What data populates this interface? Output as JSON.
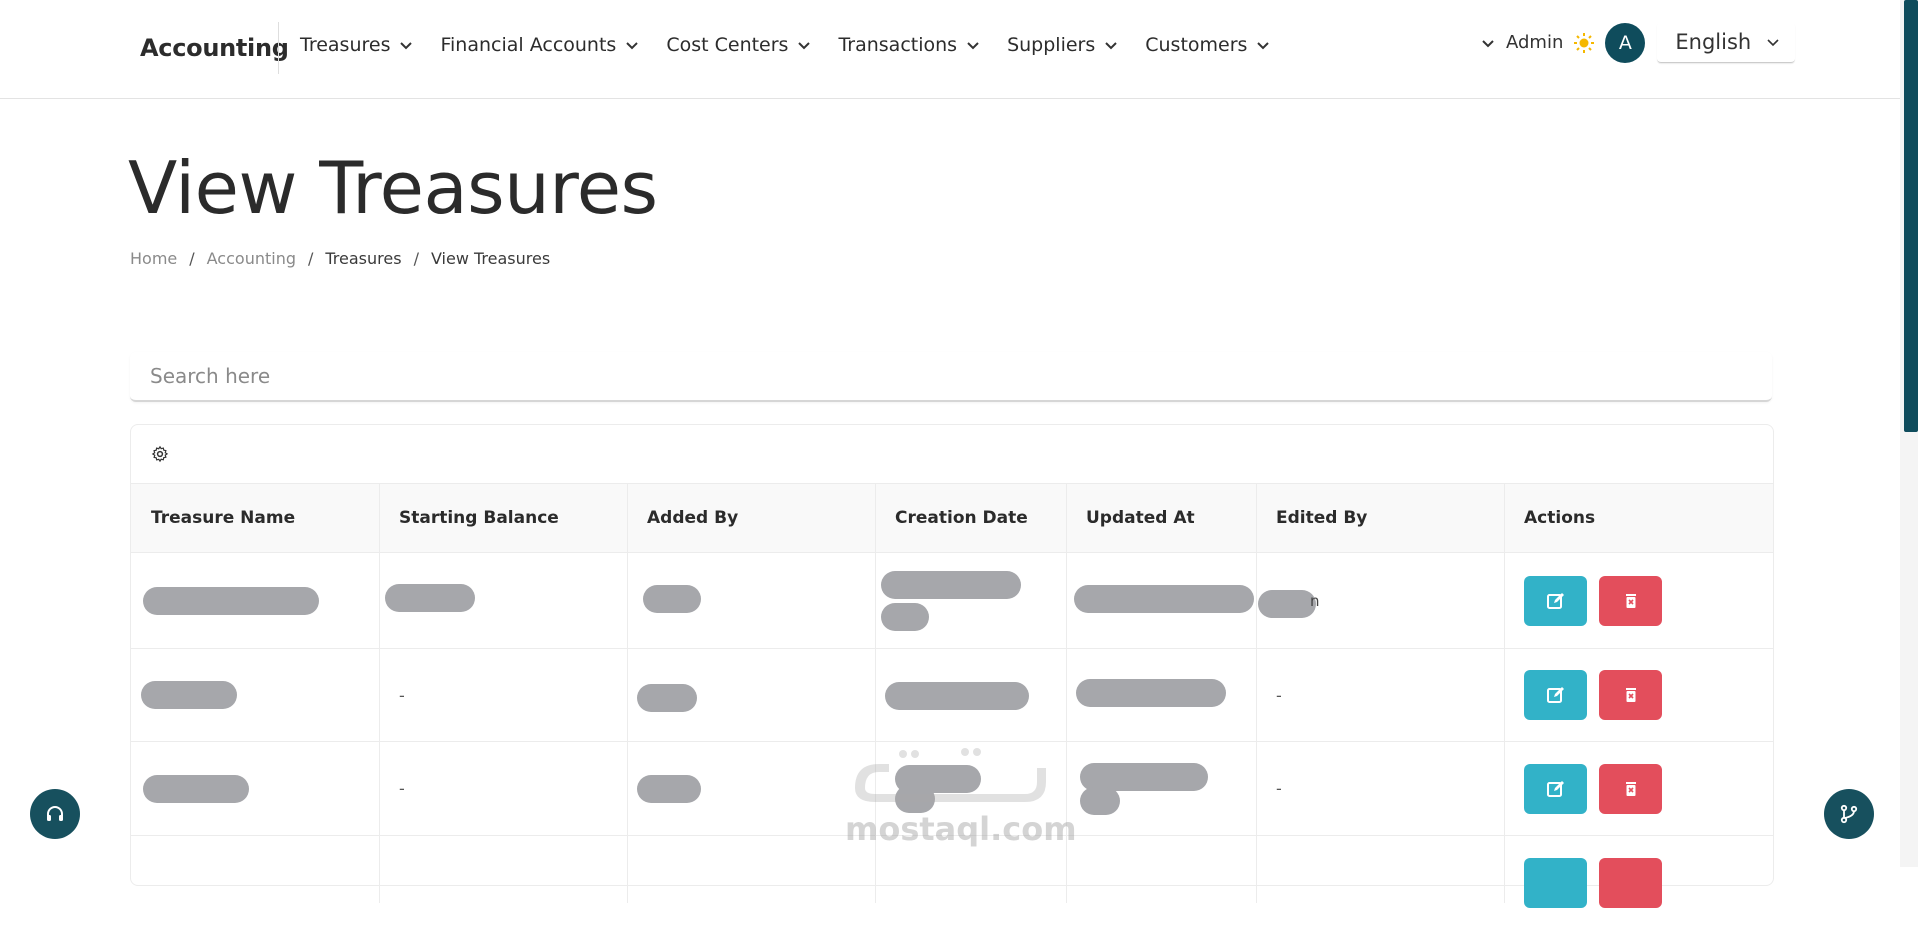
{
  "navbar": {
    "brand": "Accounting",
    "menu": [
      {
        "label": "Treasures"
      },
      {
        "label": "Financial Accounts"
      },
      {
        "label": "Cost Centers"
      },
      {
        "label": "Transactions"
      },
      {
        "label": "Suppliers"
      },
      {
        "label": "Customers"
      }
    ],
    "user_label": "Admin",
    "avatar_initial": "A",
    "language": "English"
  },
  "page": {
    "title": "View Treasures",
    "breadcrumb": [
      "Home",
      "Accounting",
      "Treasures",
      "View Treasures"
    ]
  },
  "search": {
    "placeholder": "Search here"
  },
  "table": {
    "columns": [
      "Treasure Name",
      "Starting Balance",
      "Added By",
      "Creation Date",
      "Updated At",
      "Edited By",
      "Actions"
    ],
    "rows": [
      {
        "starting_balance": "",
        "edited_by": "n"
      },
      {
        "starting_balance": "-",
        "edited_by": "-"
      },
      {
        "starting_balance": "-",
        "edited_by": "-"
      },
      {
        "starting_balance": "",
        "edited_by": ""
      }
    ]
  },
  "watermark": "mostaql.com",
  "colors": {
    "primary": "#0f4c5c",
    "edit": "#32b2c8",
    "delete": "#e34e5c",
    "redaction": "#a6a7ab"
  }
}
